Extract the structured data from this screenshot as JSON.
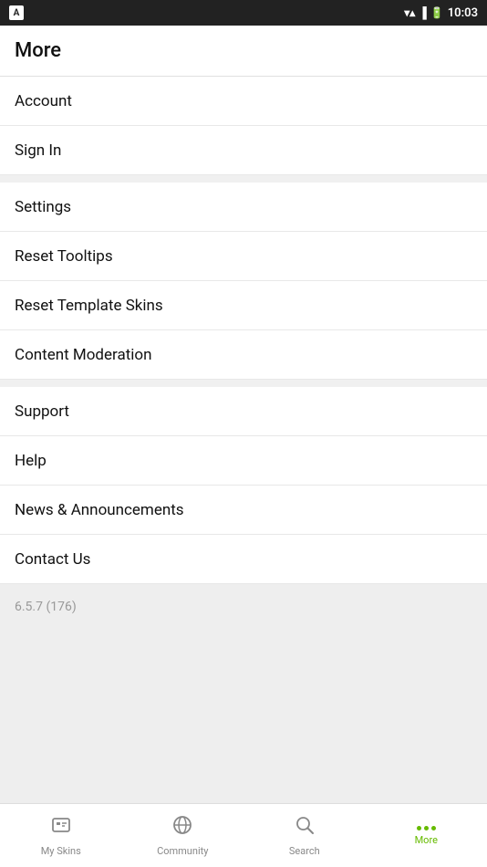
{
  "statusBar": {
    "time": "10:03"
  },
  "pageTitle": "More",
  "menuItems": [
    {
      "id": "account",
      "label": "Account"
    },
    {
      "id": "sign-in",
      "label": "Sign In"
    },
    {
      "id": "settings",
      "label": "Settings"
    },
    {
      "id": "reset-tooltips",
      "label": "Reset Tooltips"
    },
    {
      "id": "reset-template-skins",
      "label": "Reset Template Skins"
    },
    {
      "id": "content-moderation",
      "label": "Content Moderation"
    },
    {
      "id": "support",
      "label": "Support"
    },
    {
      "id": "help",
      "label": "Help"
    },
    {
      "id": "news-announcements",
      "label": "News & Announcements"
    },
    {
      "id": "contact-us",
      "label": "Contact Us"
    }
  ],
  "versionText": "6.5.7 (176)",
  "bottomNav": {
    "items": [
      {
        "id": "my-skins",
        "label": "My Skins",
        "active": false
      },
      {
        "id": "community",
        "label": "Community",
        "active": false
      },
      {
        "id": "search",
        "label": "Search",
        "active": false
      },
      {
        "id": "more",
        "label": "More",
        "active": true
      }
    ]
  }
}
